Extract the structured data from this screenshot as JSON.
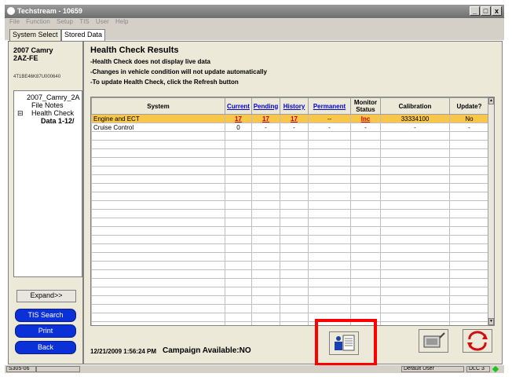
{
  "window": {
    "title": "Techstream - 10659",
    "minimize": "_",
    "maximize": "□",
    "close": "x"
  },
  "menu": [
    "File",
    "Function",
    "Setup",
    "TIS",
    "User",
    "Help"
  ],
  "tabs": [
    "System Select",
    "Stored Data"
  ],
  "vehicle": {
    "model": "2007 Camry",
    "engine": "2AZ-FE",
    "vin": "4T1BE46K87U000640"
  },
  "tree": [
    "2007_Camry_2A",
    "File Notes",
    "Health Check",
    "Data 1-12/"
  ],
  "left_buttons": {
    "expand": "Expand>>",
    "tis_search": "TIS Search",
    "print": "Print",
    "back": "Back"
  },
  "header": {
    "title": "Health Check Results",
    "notes": [
      "-Health Check does not display live data",
      "-Changes in vehicle condition will not update automatically",
      "-To update Health Check, click the Refresh button"
    ]
  },
  "table": {
    "columns": [
      "System",
      "Current",
      "Pending",
      "History",
      "Permanent",
      "Monitor Status",
      "Calibration",
      "Update?"
    ],
    "rows": [
      [
        "Engine and ECT",
        "17",
        "17",
        "17",
        "--",
        "Inc",
        "33334100",
        "No"
      ],
      [
        "Cruise Control",
        "0",
        "-",
        "-",
        "-",
        "-",
        "-",
        "-"
      ]
    ]
  },
  "footer": {
    "timestamp": "12/21/2009 1:56:24 PM",
    "campaign": "Campaign Available:NO"
  },
  "icons": {
    "report": "report-icon",
    "ecu": "ecu-icon",
    "refresh": "refresh-icon"
  },
  "status_bar": {
    "code": "S305-06",
    "user": "Default User",
    "dlc": "DLC 3"
  },
  "colors": {
    "selected_row": "#f7c64a",
    "link_red": "#cc0000",
    "blue_button": "#0b30d8",
    "highlight": "#ff0000"
  }
}
